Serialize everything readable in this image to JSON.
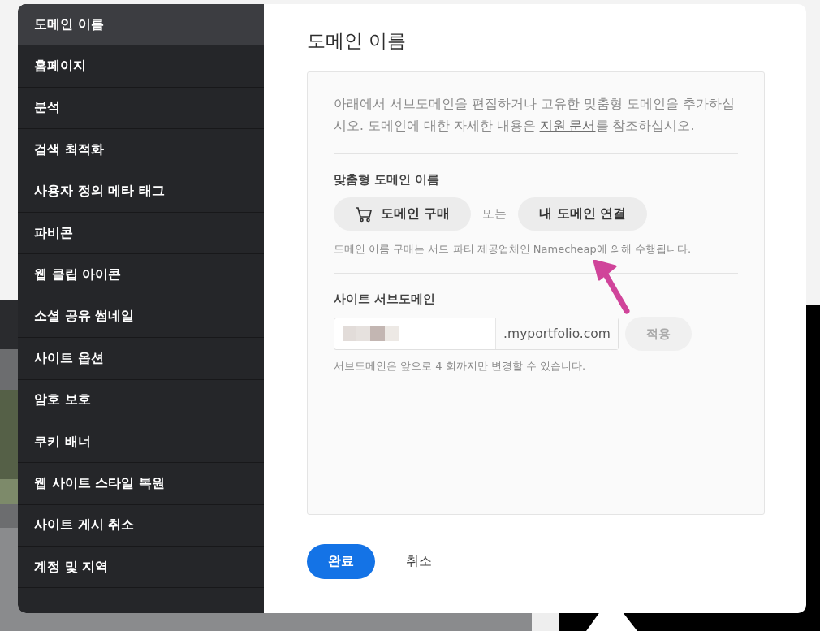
{
  "sidebar": {
    "items": [
      {
        "label": "도메인 이름",
        "selected": true
      },
      {
        "label": "홈페이지",
        "selected": false
      },
      {
        "label": "분석",
        "selected": false
      },
      {
        "label": "검색 최적화",
        "selected": false
      },
      {
        "label": "사용자 정의 메타 태그",
        "selected": false
      },
      {
        "label": "파비콘",
        "selected": false
      },
      {
        "label": "웹 클립 아이콘",
        "selected": false
      },
      {
        "label": "소셜 공유 썸네일",
        "selected": false
      },
      {
        "label": "사이트 옵션",
        "selected": false
      },
      {
        "label": "암호 보호",
        "selected": false
      },
      {
        "label": "쿠키 배너",
        "selected": false
      },
      {
        "label": "웹 사이트 스타일 복원",
        "selected": false
      },
      {
        "label": "사이트 게시 취소",
        "selected": false
      },
      {
        "label": "계정 및 지역",
        "selected": false
      }
    ]
  },
  "title": "도메인 이름",
  "intro": {
    "before": "아래에서 서브도메인을 편집하거나 고유한 맞춤형 도메인을 추가하십시오. 도메인에 대한 자세한 내용은 ",
    "link": "지원 문서",
    "after": "를 참조하십시오."
  },
  "custom_domain": {
    "heading": "맞춤형 도메인 이름",
    "buy_button": "도메인 구매",
    "or": "또는",
    "connect_button": "내 도메인 연결",
    "note": "도메인 이름 구매는 서드 파티 제공업체인 Namecheap에 의해 수행됩니다."
  },
  "subdomain": {
    "heading": "사이트 서브도메인",
    "suffix": ".myportfolio.com",
    "apply_button": "적용",
    "apply_disabled": true,
    "note": "서브도메인은 앞으로 4 회까지만 변경할 수 있습니다."
  },
  "footer": {
    "done_button": "완료",
    "cancel_button": "취소"
  }
}
